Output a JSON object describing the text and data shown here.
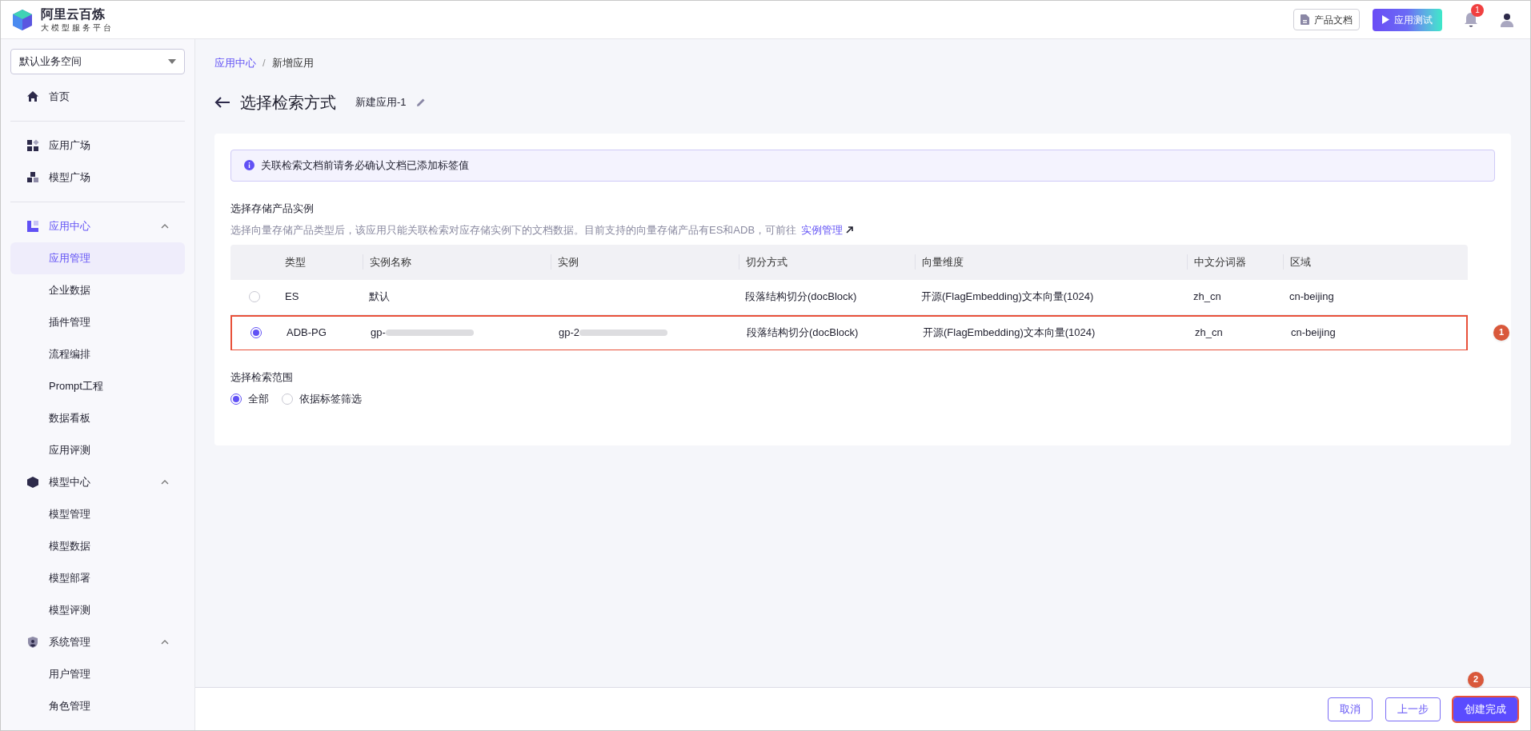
{
  "header": {
    "brand": "阿里云百炼",
    "tagline": "大模型服务平台",
    "docs_button": "产品文档",
    "test_button": "应用测试",
    "notification_count": "1"
  },
  "sidebar": {
    "workspace": "默认业务空间",
    "sections": [
      [
        {
          "label": "首页"
        }
      ],
      [
        {
          "label": "应用广场"
        },
        {
          "label": "模型广场"
        }
      ],
      [
        {
          "label": "应用中心",
          "active": true,
          "expanded": true,
          "children": [
            {
              "label": "应用管理",
              "selected": true
            },
            {
              "label": "企业数据",
              "selected": false
            },
            {
              "label": "插件管理",
              "selected": false
            },
            {
              "label": "流程编排",
              "selected": false
            },
            {
              "label": "Prompt工程",
              "selected": false
            },
            {
              "label": "数据看板",
              "selected": false
            },
            {
              "label": "应用评测",
              "selected": false
            }
          ]
        },
        {
          "label": "模型中心",
          "active": false,
          "expanded": true,
          "children": [
            {
              "label": "模型管理",
              "selected": false
            },
            {
              "label": "模型数据",
              "selected": false
            },
            {
              "label": "模型部署",
              "selected": false
            },
            {
              "label": "模型评测",
              "selected": false
            }
          ]
        },
        {
          "label": "系统管理",
          "active": false,
          "expanded": true,
          "children": [
            {
              "label": "用户管理",
              "selected": false
            },
            {
              "label": "角色管理",
              "selected": false
            }
          ]
        }
      ]
    ]
  },
  "breadcrumb": {
    "separator": "/",
    "items": [
      {
        "label": "应用中心",
        "link": true
      },
      {
        "label": "新增应用",
        "link": false
      }
    ]
  },
  "page_title": "选择检索方式",
  "app_name": "新建应用-1",
  "notice": "关联检索文档前请务必确认文档已添加标签值",
  "storage": {
    "title": "选择存储产品实例",
    "description": "选择向量存储产品类型后，该应用只能关联检索对应存储实例下的文档数据。目前支持的向量存储产品有ES和ADB，可前往",
    "link": "实例管理",
    "columns": [
      "类型",
      "实例名称",
      "实例",
      "切分方式",
      "向量维度",
      "中文分词器",
      "区域"
    ],
    "rows": [
      {
        "selected": false,
        "highlighted": false,
        "cells": [
          {
            "text": "ES",
            "redacted": false
          },
          {
            "text": "默认",
            "redacted": false
          },
          {
            "redacted": false
          },
          {
            "text": "段落结构切分(docBlock)",
            "redacted": false
          },
          {
            "text": "开源(FlagEmbedding)文本向量(1024)",
            "redacted": false
          },
          {
            "text": "zh_cn",
            "redacted": false
          },
          {
            "text": "cn-beijing",
            "redacted": false
          }
        ]
      },
      {
        "selected": true,
        "highlighted": true,
        "callout": "1",
        "cells": [
          {
            "text": "ADB-PG",
            "redacted": false
          },
          {
            "text": "gp-",
            "redacted": true
          },
          {
            "text": "gp-2",
            "redacted": true
          },
          {
            "text": "段落结构切分(docBlock)",
            "redacted": false
          },
          {
            "text": "开源(FlagEmbedding)文本向量(1024)",
            "redacted": false
          },
          {
            "text": "zh_cn",
            "redacted": false
          },
          {
            "text": "cn-beijing",
            "redacted": false
          }
        ]
      }
    ]
  },
  "scope": {
    "title": "选择检索范围",
    "options": [
      {
        "label": "全部",
        "selected": true
      },
      {
        "label": "依据标签筛选",
        "selected": false
      }
    ]
  },
  "footer": {
    "buttons": [
      {
        "label": "取消",
        "kind": "outline",
        "highlighted": false
      },
      {
        "label": "上一步",
        "kind": "outline",
        "highlighted": false
      },
      {
        "label": "创建完成",
        "kind": "primary",
        "highlighted": true,
        "callout": "2"
      }
    ]
  }
}
